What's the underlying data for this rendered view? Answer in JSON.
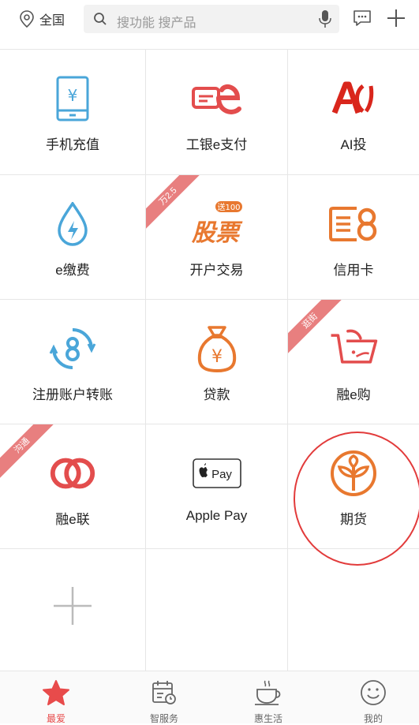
{
  "header": {
    "location": "全国",
    "search_placeholder": "搜功能 搜产品"
  },
  "grid": {
    "items": [
      {
        "label": "手机充值",
        "icon": "phone-topup-icon"
      },
      {
        "label": "工银e支付",
        "icon": "icbc-epay-icon"
      },
      {
        "label": "AI投",
        "icon": "ai-invest-icon"
      },
      {
        "label": "e缴费",
        "icon": "water-bill-icon"
      },
      {
        "label": "开户交易",
        "icon": "stock-account-icon",
        "ribbon": "万2.5",
        "badge": "送100",
        "icon_text": "股票"
      },
      {
        "label": "信用卡",
        "icon": "credit-card-icon"
      },
      {
        "label": "注册账户转账",
        "icon": "transfer-icon"
      },
      {
        "label": "贷款",
        "icon": "loan-bag-icon"
      },
      {
        "label": "融e购",
        "icon": "shopping-cart-icon",
        "ribbon": "逛街"
      },
      {
        "label": "融e联",
        "icon": "chat-rings-icon",
        "ribbon": "沟通"
      },
      {
        "label": "Apple Pay",
        "icon": "apple-pay-icon",
        "icon_text": "Pay"
      },
      {
        "label": "期货",
        "icon": "futures-leaf-icon"
      },
      {
        "label": "",
        "icon": "add-icon"
      }
    ]
  },
  "tabs": [
    {
      "label": "最爱",
      "icon": "star-icon",
      "active": true
    },
    {
      "label": "智服务",
      "icon": "calendar-icon"
    },
    {
      "label": "惠生活",
      "icon": "coffee-icon"
    },
    {
      "label": "我的",
      "icon": "smile-icon"
    }
  ],
  "colors": {
    "blue": "#4aa6d9",
    "red": "#e34d4d",
    "orange": "#e8782f",
    "ribbon": "#e87f7f",
    "annotation": "#e23b3b"
  }
}
